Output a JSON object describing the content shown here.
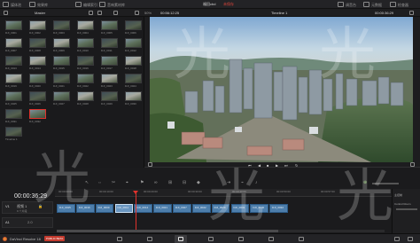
{
  "toolbar": {
    "media_pool": "媒体池",
    "effects": "效果库",
    "edit_index": "编辑索引",
    "sound_library": "音响素材库",
    "project_title": "福田cbd",
    "status": "未保存",
    "mixer": "调音台",
    "metadata": "元数据",
    "inspector": "检查器"
  },
  "pool_bar": {
    "bin_name": "Master",
    "zoom": "50%",
    "source_timecode": "00:56:12:25",
    "timeline_name": "Timeline 1",
    "record_timecode": "00:00:36:29"
  },
  "media_pool": {
    "clips": [
      "DJI_0001",
      "DJI_0002",
      "DJI_0003",
      "DJI_0004",
      "DJI_0005",
      "DJI_0006",
      "DJI_0007",
      "DJI_0008",
      "DJI_0009",
      "DJI_0010",
      "DJI_0011",
      "DJI_0012",
      "DJI_0013",
      "DJI_0014",
      "DJI_0015",
      "DJI_0016",
      "DJI_0017",
      "DJI_0018",
      "DJI_0019",
      "DJI_0020",
      "DJI_0021",
      "DJI_0022",
      "DJI_0023",
      "DJI_0024",
      "DJI_0025",
      "DJI_0026",
      "DJI_0027",
      "DJI_0028",
      "DJI_0029",
      "DJI_0030",
      "DJI_0031",
      "DJI_0032"
    ],
    "timeline_label": "Timeline 1"
  },
  "timeline": {
    "timecode": "00:00:36:29",
    "ruler": [
      "00:00:00:00",
      "00:00:10:00",
      "00:00:20:00",
      "00:00:30:00",
      "00:00:40:00",
      "00:00:50:00",
      "00:00:57:00"
    ],
    "video_track": {
      "id": "V1",
      "name": "视频 1",
      "clip_count": "9 个片段"
    },
    "audio_track": {
      "id": "A1",
      "level": "2.0"
    },
    "clips": [
      "DJI_0015",
      "DJI_0016",
      "DJI_0009",
      "DJI_0011",
      "DJI_0014",
      "DJI_0021",
      "DJI_0027",
      "DJI_0022",
      "DJI_0029",
      "DJI_0031",
      "DJI_0030",
      "DJI_0032"
    ],
    "right_panel_title": "Control Room",
    "right_panel_label": "主控制"
  },
  "page_bar": {
    "app_name": "DaVinci Resolve 18",
    "badge": "PUBLIC BETA"
  },
  "watermark": "光"
}
